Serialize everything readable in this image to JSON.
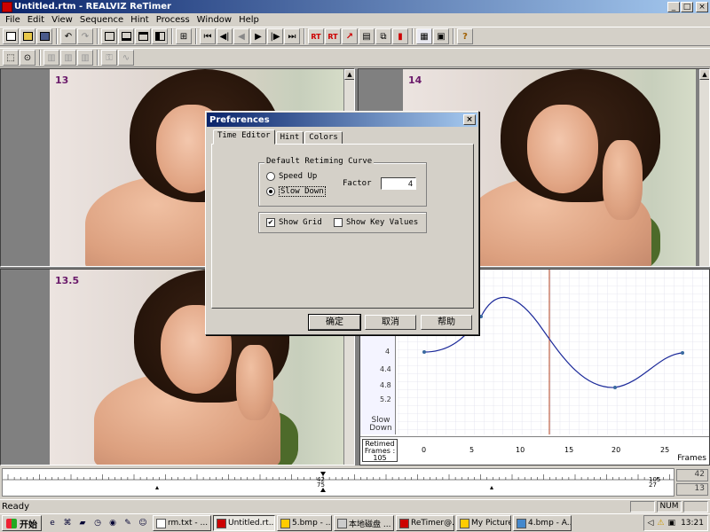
{
  "window": {
    "title": "Untitled.rtm - REALVIZ ReTimer",
    "minimize": "_",
    "maximize": "□",
    "close": "×"
  },
  "menu": [
    "File",
    "Edit",
    "View",
    "Sequence",
    "Hint",
    "Process",
    "Window",
    "Help"
  ],
  "toolbar": {
    "rt_label": "RT"
  },
  "views": {
    "top_left_frame": "13",
    "top_right_frame": "14",
    "bottom_left_frame": "13.5"
  },
  "graph": {
    "y_ticks": [
      "4",
      "4.4",
      "4.8",
      "5.2"
    ],
    "side_label": "Slow Down",
    "retimed_label": "Retimed Frames :",
    "retimed_value": "105",
    "x_ticks": [
      "0",
      "5",
      "10",
      "15",
      "20",
      "25"
    ],
    "frames_label": "Frames",
    "accent_color": "#1c2a9a"
  },
  "timeline": {
    "ruler_marks": [
      "42",
      "75",
      "105",
      "27"
    ],
    "counter_top": "42",
    "counter_bottom": "13"
  },
  "status": {
    "message": "Ready",
    "num": "NUM"
  },
  "taskbar": {
    "start": "开始",
    "tasks": [
      "rm.txt - ...",
      "Untitled.rt...",
      "5.bmp - ...",
      "本地磁盘 ...",
      "ReTimer@...",
      "My Pictures",
      "4.bmp - A..."
    ],
    "clock": "13:21"
  },
  "dialog": {
    "title": "Preferences",
    "close": "×",
    "tabs": [
      "Time Editor",
      "Hint",
      "Colors"
    ],
    "group_title": "Default Retiming Curve",
    "speed_up": "Speed Up",
    "slow_down": "Slow Down",
    "factor_label": "Factor",
    "factor_value": "4",
    "show_grid": "Show Grid",
    "show_grid_check": "✔",
    "show_key_values": "Show Key Values",
    "ok": "确定",
    "cancel": "取消",
    "help": "帮助"
  }
}
